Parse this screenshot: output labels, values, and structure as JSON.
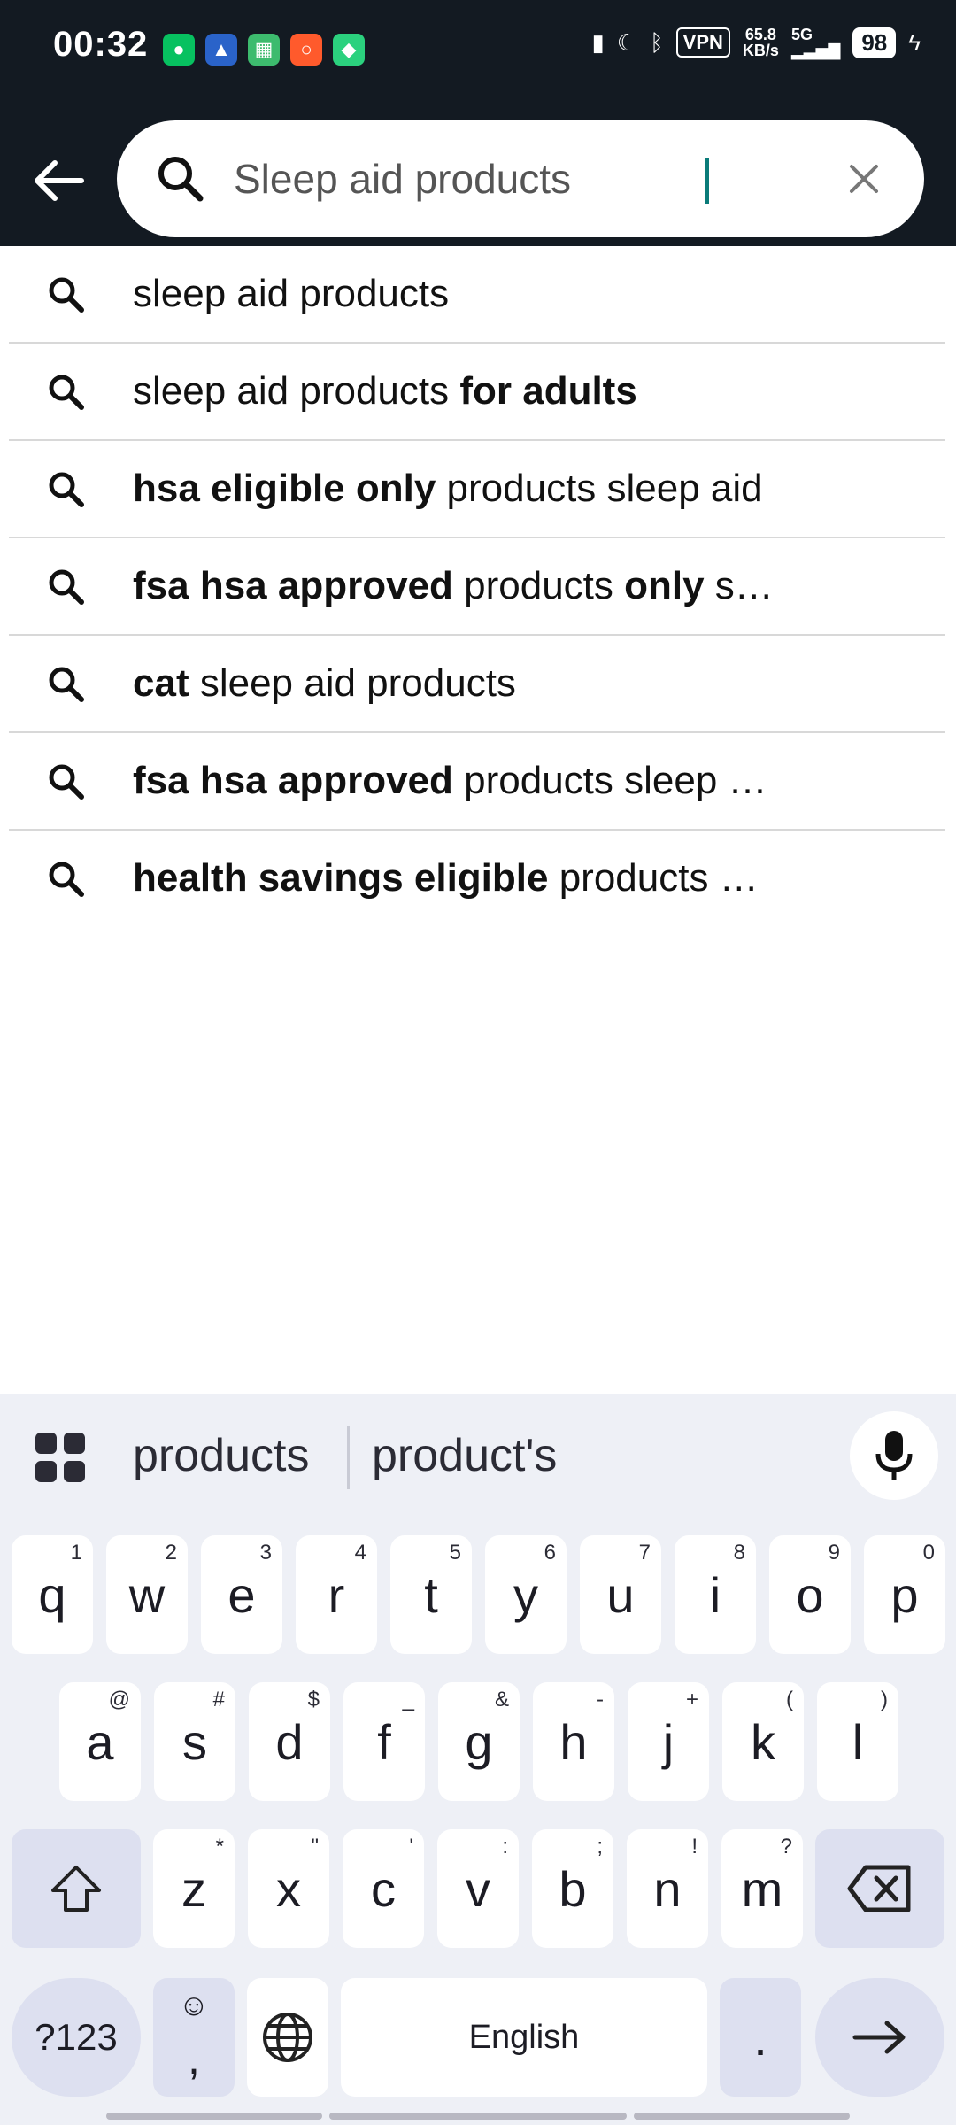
{
  "status_bar": {
    "time": "00:32",
    "vpn": "VPN",
    "speed_value": "65.8",
    "speed_unit": "KB/s",
    "network": "5G",
    "battery": "98"
  },
  "search": {
    "query": "Sleep aid products"
  },
  "suggestions": [
    {
      "parts": [
        {
          "t": "sleep aid products",
          "b": false
        }
      ]
    },
    {
      "parts": [
        {
          "t": "sleep aid products ",
          "b": false
        },
        {
          "t": "for adults",
          "b": true
        }
      ]
    },
    {
      "parts": [
        {
          "t": "hsa eligible only",
          "b": true
        },
        {
          "t": " products sleep aid",
          "b": false
        }
      ]
    },
    {
      "parts": [
        {
          "t": "fsa hsa approved",
          "b": true
        },
        {
          "t": " products ",
          "b": false
        },
        {
          "t": "only",
          "b": true
        },
        {
          "t": " s…",
          "b": false
        }
      ]
    },
    {
      "parts": [
        {
          "t": "cat",
          "b": true
        },
        {
          "t": " sleep aid products",
          "b": false
        }
      ]
    },
    {
      "parts": [
        {
          "t": "fsa hsa approved",
          "b": true
        },
        {
          "t": " products sleep …",
          "b": false
        }
      ]
    },
    {
      "parts": [
        {
          "t": "health savings eligible",
          "b": true
        },
        {
          "t": " products …",
          "b": false
        }
      ]
    }
  ],
  "keyboard": {
    "word_suggestions": [
      "products",
      "product's"
    ],
    "row1": [
      {
        "k": "q",
        "h": "1"
      },
      {
        "k": "w",
        "h": "2"
      },
      {
        "k": "e",
        "h": "3"
      },
      {
        "k": "r",
        "h": "4"
      },
      {
        "k": "t",
        "h": "5"
      },
      {
        "k": "y",
        "h": "6"
      },
      {
        "k": "u",
        "h": "7"
      },
      {
        "k": "i",
        "h": "8"
      },
      {
        "k": "o",
        "h": "9"
      },
      {
        "k": "p",
        "h": "0"
      }
    ],
    "row2": [
      {
        "k": "a",
        "h": "@"
      },
      {
        "k": "s",
        "h": "#"
      },
      {
        "k": "d",
        "h": "$"
      },
      {
        "k": "f",
        "h": "_"
      },
      {
        "k": "g",
        "h": "&"
      },
      {
        "k": "h",
        "h": "-"
      },
      {
        "k": "j",
        "h": "+"
      },
      {
        "k": "k",
        "h": "("
      },
      {
        "k": "l",
        "h": ")"
      }
    ],
    "row3": [
      {
        "k": "z",
        "h": "*"
      },
      {
        "k": "x",
        "h": "\""
      },
      {
        "k": "c",
        "h": "'"
      },
      {
        "k": "v",
        "h": ":"
      },
      {
        "k": "b",
        "h": ";"
      },
      {
        "k": "n",
        "h": "!"
      },
      {
        "k": "m",
        "h": "?"
      }
    ],
    "symbols_label": "?123",
    "comma_label": ",",
    "space_label": "English",
    "period_label": "."
  }
}
